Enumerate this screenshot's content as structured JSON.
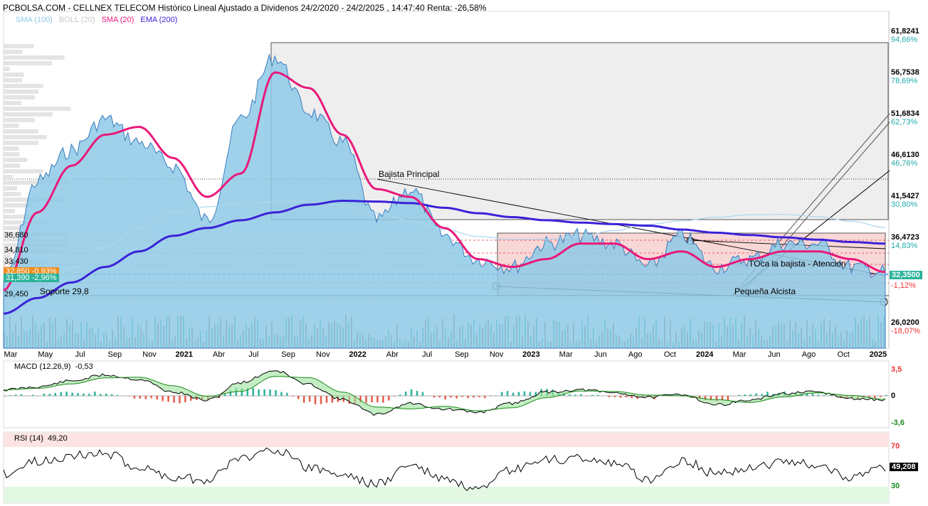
{
  "header": {
    "title": "PCBOLSA.COM - CELLNEX TELECOM Histórico Lineal Ajustado a Dividenos 24/2/2020 - 24/2/2025 , 14:47:40 Renta: -26,58%",
    "legend": [
      {
        "label": "SMA (100)",
        "color": "#8ec8e8"
      },
      {
        "label": "BOLL (20)",
        "color": "#c8c8c8"
      },
      {
        "label": "SMA (20)",
        "color": "#e8197a"
      },
      {
        "label": "EMA (200)",
        "color": "#3a22d8"
      }
    ]
  },
  "colors": {
    "price_fill": "#8ecae6",
    "price_line": "#3a7bbf",
    "sma20": "#e8197a",
    "ema200": "#3a22d8",
    "sma100": "#a9d6f0",
    "vol_up": "#2bb39a",
    "vol_down": "#a0606e"
  },
  "chart_data": [
    {
      "type": "area",
      "name": "price",
      "x": [
        "2020-03",
        "2020-05",
        "2020-07",
        "2020-09",
        "2020-11",
        "2021-01",
        "2021-04",
        "2021-07",
        "2021-09",
        "2021-11",
        "2022-01",
        "2022-04",
        "2022-07",
        "2022-09",
        "2022-11",
        "2023-01",
        "2023-03",
        "2023-06",
        "2023-08",
        "2023-10",
        "2024-01",
        "2024-03",
        "2024-06",
        "2024-08",
        "2024-10",
        "2025-01",
        "2025-02"
      ],
      "ylim": [
        26.02,
        61.8241
      ],
      "x_ticks": [
        "Mar",
        "May",
        "Jul",
        "Sep",
        "Nov",
        "2021",
        "Abr",
        "Jul",
        "Sep",
        "Nov",
        "2022",
        "Abr",
        "Jul",
        "Sep",
        "Nov",
        "2023",
        "Mar",
        "Jun",
        "Ago",
        "Oct",
        "2024",
        "Mar",
        "Jun",
        "Ago",
        "Oct",
        "2025"
      ],
      "y_ticks": [
        {
          "value": "61,8241",
          "pct": "94,66%"
        },
        {
          "value": "56,7538",
          "pct": "78,69%"
        },
        {
          "value": "51,6834",
          "pct": "62,73%"
        },
        {
          "value": "46,6130",
          "pct": "46,76%"
        },
        {
          "value": "41,5427",
          "pct": "30,80%"
        },
        {
          "value": "36,4723",
          "pct": "14,83%"
        },
        {
          "value": "32,3500",
          "pct": "-1,12%"
        },
        {
          "value": "26,0200",
          "pct": "-18,07%"
        }
      ],
      "series": [
        {
          "name": "Precio",
          "values": [
            31,
            44,
            48,
            52,
            49,
            46,
            39,
            52,
            60,
            53,
            49,
            39,
            43,
            37,
            34,
            33,
            36,
            37,
            36,
            33,
            37,
            33,
            34,
            36,
            36,
            33,
            32.35
          ]
        },
        {
          "name": "SMA (20)",
          "values": [
            30,
            40,
            46,
            50,
            51,
            47,
            42,
            45,
            58,
            56,
            50,
            43,
            42,
            38,
            34,
            33,
            34,
            36,
            36,
            34,
            35,
            33,
            34,
            35,
            35,
            34,
            32.35
          ]
        },
        {
          "name": "EMA (200)",
          "values": [
            27,
            29,
            31,
            33,
            35,
            37,
            38,
            39,
            40,
            41,
            41.5,
            41.4,
            41.2,
            40.6,
            39.9,
            39.4,
            39.0,
            38.7,
            38.5,
            38.3,
            37.8,
            37.4,
            37.1,
            36.8,
            36.5,
            36.2,
            36.0
          ]
        }
      ],
      "left_levels": [
        "36,680",
        "34,810",
        "33,430",
        "32,850 -0,93%",
        "31,390 -2,96%",
        "29,450"
      ],
      "current_price": "32,3500",
      "annotations": [
        "Bajista Principal",
        "TOca la bajista - Atencion",
        "Pequeña Alcista",
        "Soporte 29,8"
      ]
    },
    {
      "type": "line",
      "name": "MACD (12,26,9)",
      "title": "MACD (12,26,9)",
      "last_value": "-0,53",
      "y_ticks": [
        "3,5",
        "0",
        "-3,6"
      ],
      "series": [
        {
          "name": "MACD",
          "values": [
            0.8,
            1.2,
            2.0,
            2.8,
            2.2,
            0.5,
            -0.6,
            1.8,
            3.4,
            1.5,
            -0.5,
            -2.5,
            -1.0,
            -1.8,
            -2.2,
            -1.0,
            0.5,
            0.8,
            0.4,
            -0.2,
            0.2,
            -1.2,
            -0.6,
            0.3,
            0.5,
            -0.4,
            -0.53
          ]
        }
      ]
    },
    {
      "type": "line",
      "name": "RSI (14)",
      "title": "RSI (14)",
      "last_value": "49,20",
      "current": "49,208",
      "y_ticks": [
        "70",
        "30"
      ],
      "series": [
        {
          "name": "RSI",
          "values": [
            45,
            55,
            60,
            62,
            50,
            42,
            40,
            58,
            66,
            50,
            44,
            36,
            52,
            40,
            30,
            48,
            56,
            58,
            54,
            40,
            56,
            45,
            50,
            55,
            52,
            42,
            49.2
          ]
        }
      ]
    }
  ]
}
